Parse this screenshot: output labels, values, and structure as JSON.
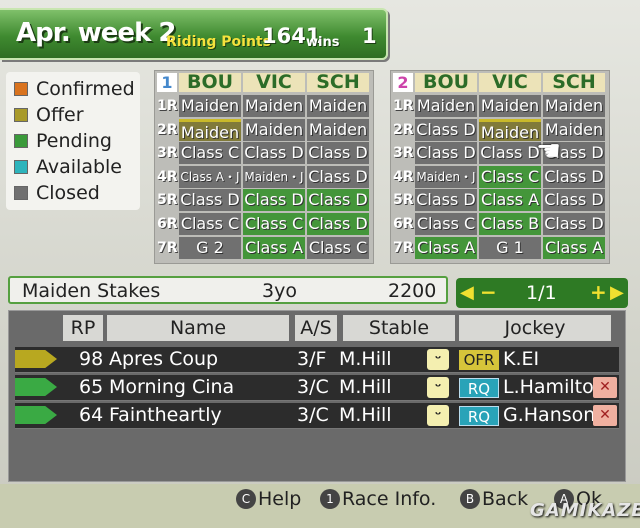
{
  "header": {
    "date": "Apr. week 2",
    "riding_points_label": "Riding Points",
    "riding_points": "1641",
    "wins_label": "wins",
    "wins": "1"
  },
  "legend": [
    {
      "label": "Confirmed",
      "color": "#d9731e"
    },
    {
      "label": "Offer",
      "color": "#a89a2a"
    },
    {
      "label": "Pending",
      "color": "#3a9a3a"
    },
    {
      "label": "Available",
      "color": "#2db4bc"
    },
    {
      "label": "Closed",
      "color": "#707070"
    }
  ],
  "schedule1": {
    "number": "1",
    "number_color": "#4488cc",
    "tracks": [
      "BOU",
      "VIC",
      "SCH"
    ],
    "rows": [
      {
        "label": "1R",
        "cells": [
          {
            "t": "Maiden",
            "s": "closed"
          },
          {
            "t": "Maiden",
            "s": "closed"
          },
          {
            "t": "Maiden",
            "s": "closed"
          }
        ]
      },
      {
        "label": "2R",
        "cells": [
          {
            "t": "Maiden",
            "s": "offer"
          },
          {
            "t": "Maiden",
            "s": "closed"
          },
          {
            "t": "Maiden",
            "s": "closed"
          }
        ]
      },
      {
        "label": "3R",
        "cells": [
          {
            "t": "Class C",
            "s": "closed"
          },
          {
            "t": "Class D",
            "s": "closed"
          },
          {
            "t": "Class D",
            "s": "closed"
          }
        ]
      },
      {
        "label": "4R",
        "cells": [
          {
            "t": "Class A・J",
            "s": "closed",
            "n": true
          },
          {
            "t": "Maiden・J",
            "s": "closed",
            "n": true
          },
          {
            "t": "Class D",
            "s": "closed"
          }
        ]
      },
      {
        "label": "5R",
        "cells": [
          {
            "t": "Class D",
            "s": "closed"
          },
          {
            "t": "Class D",
            "s": "green"
          },
          {
            "t": "Class D",
            "s": "green"
          }
        ]
      },
      {
        "label": "6R",
        "cells": [
          {
            "t": "Class C",
            "s": "closed"
          },
          {
            "t": "Class C",
            "s": "green"
          },
          {
            "t": "Class D",
            "s": "green"
          }
        ]
      },
      {
        "label": "7R",
        "cells": [
          {
            "t": "G 2",
            "s": "closed"
          },
          {
            "t": "Class A",
            "s": "green"
          },
          {
            "t": "Class C",
            "s": "closed"
          }
        ]
      }
    ]
  },
  "schedule2": {
    "number": "2",
    "number_color": "#cc44aa",
    "tracks": [
      "BOU",
      "VIC",
      "SCH"
    ],
    "rows": [
      {
        "label": "1R",
        "cells": [
          {
            "t": "Maiden",
            "s": "closed"
          },
          {
            "t": "Maiden",
            "s": "closed"
          },
          {
            "t": "Maiden",
            "s": "closed"
          }
        ]
      },
      {
        "label": "2R",
        "cells": [
          {
            "t": "Class D",
            "s": "closed"
          },
          {
            "t": "Maiden",
            "s": "offer"
          },
          {
            "t": "Maiden",
            "s": "closed"
          }
        ]
      },
      {
        "label": "3R",
        "cells": [
          {
            "t": "Class D",
            "s": "closed"
          },
          {
            "t": "Class D",
            "s": "closed"
          },
          {
            "t": "Class D",
            "s": "closed"
          }
        ]
      },
      {
        "label": "4R",
        "cells": [
          {
            "t": "Maiden・J",
            "s": "closed",
            "n": true
          },
          {
            "t": "Class C",
            "s": "green"
          },
          {
            "t": "Class D",
            "s": "closed"
          }
        ]
      },
      {
        "label": "5R",
        "cells": [
          {
            "t": "Class D",
            "s": "closed"
          },
          {
            "t": "Class A",
            "s": "green"
          },
          {
            "t": "Class D",
            "s": "closed"
          }
        ]
      },
      {
        "label": "6R",
        "cells": [
          {
            "t": "Class C",
            "s": "closed"
          },
          {
            "t": "Class B",
            "s": "green"
          },
          {
            "t": "Class D",
            "s": "closed"
          }
        ]
      },
      {
        "label": "7R",
        "cells": [
          {
            "t": "Class A",
            "s": "green"
          },
          {
            "t": "G 1",
            "s": "closed"
          },
          {
            "t": "Class A",
            "s": "green"
          }
        ]
      }
    ]
  },
  "race": {
    "name": "Maiden Stakes",
    "age": "3yo",
    "distance": "2200"
  },
  "pager": {
    "minus": "−",
    "page": "1/1",
    "plus": "+"
  },
  "columns": [
    "RP",
    "Name",
    "A/S",
    "Stable",
    "Jockey"
  ],
  "horses": [
    {
      "rp": "98",
      "name": "Apres Coup",
      "as": "3/F",
      "stable": "M.Hill",
      "face": "ᵕ",
      "tag": "OFR",
      "tag_type": "ofr",
      "jockey": "K.EI",
      "mood": "",
      "flag": "#b8a820"
    },
    {
      "rp": "65",
      "name": "Morning Cina",
      "as": "3/C",
      "stable": "M.Hill",
      "face": "ᵕ",
      "tag": "RQ",
      "tag_type": "rq",
      "jockey": "L.Hamilton",
      "mood": "✕",
      "flag": "#3aaa44"
    },
    {
      "rp": "64",
      "name": "Faintheartly",
      "as": "3/C",
      "stable": "M.Hill",
      "face": "ᵕ",
      "tag": "RQ",
      "tag_type": "rq",
      "jockey": "G.Hanson",
      "mood": "✕",
      "flag": "#3aaa44"
    }
  ],
  "footer": [
    {
      "icon": "C",
      "label": "Help"
    },
    {
      "icon": "1",
      "label": "Race Info."
    },
    {
      "icon": "B",
      "label": "Back"
    },
    {
      "icon": "A",
      "label": "Ok"
    }
  ],
  "watermark": "GAMIKAZE"
}
